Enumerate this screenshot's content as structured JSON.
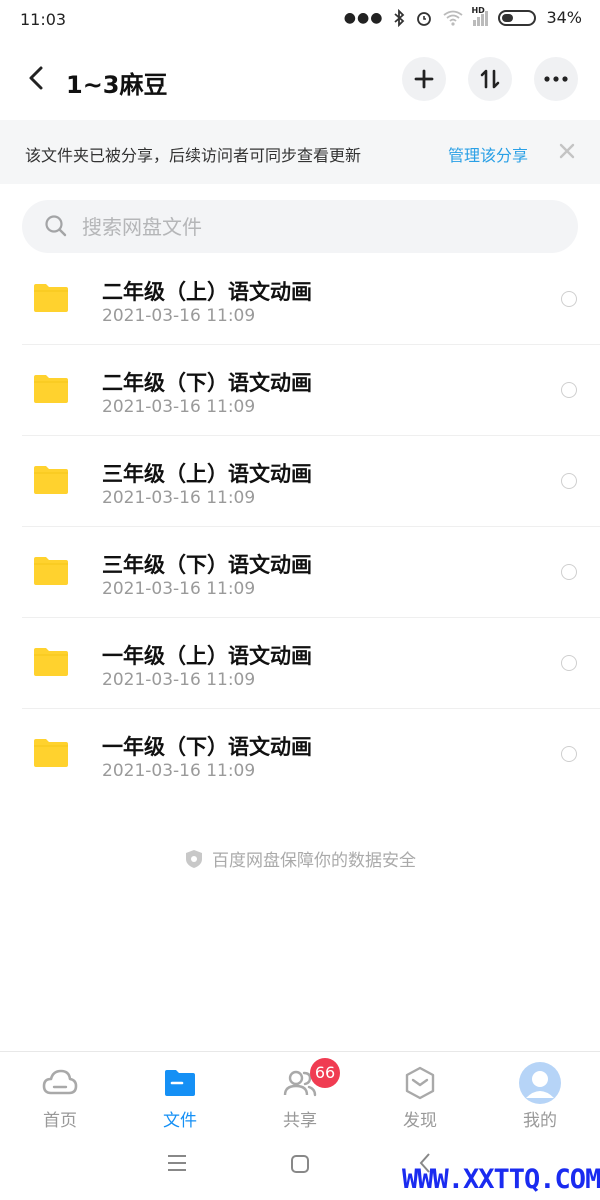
{
  "status_bar": {
    "time": "11:03",
    "battery": "34%",
    "hd": "HD"
  },
  "header": {
    "title": "1~3麻豆"
  },
  "banner": {
    "message": "该文件夹已被分享，后续访问者可同步查看更新",
    "link": "管理该分享"
  },
  "search": {
    "placeholder": "搜索网盘文件"
  },
  "files": [
    {
      "name": "二年级（上）语文动画",
      "date": "2021-03-16  11:09"
    },
    {
      "name": "二年级（下）语文动画",
      "date": "2021-03-16  11:09"
    },
    {
      "name": "三年级（上）语文动画",
      "date": "2021-03-16  11:09"
    },
    {
      "name": "三年级（下）语文动画",
      "date": "2021-03-16  11:09"
    },
    {
      "name": "一年级（上）语文动画",
      "date": "2021-03-16  11:09"
    },
    {
      "name": "一年级（下）语文动画",
      "date": "2021-03-16  11:09"
    }
  ],
  "footer_note": "百度网盘保障你的数据安全",
  "tabs": [
    {
      "label": "首页",
      "icon": "cloud-icon"
    },
    {
      "label": "文件",
      "icon": "folder-icon"
    },
    {
      "label": "共享",
      "icon": "people-icon",
      "badge": "66"
    },
    {
      "label": "发现",
      "icon": "discover-icon"
    },
    {
      "label": "我的",
      "icon": "avatar-icon"
    }
  ],
  "watermark": "WWW.XXTTQ.COM",
  "colors": {
    "accent": "#1590f5",
    "folder": "#ffd22e",
    "badge": "#f03c52",
    "link": "#2aa0e6"
  }
}
